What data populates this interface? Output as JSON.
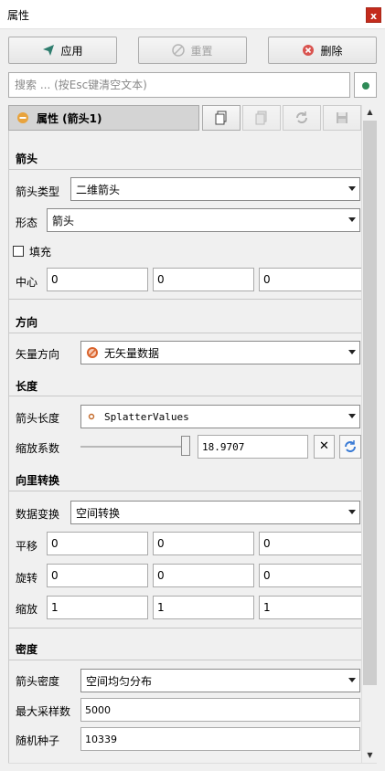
{
  "window": {
    "title": "属性",
    "close_glyph": "x"
  },
  "toolbar": {
    "apply_label": "应用",
    "reset_label": "重置",
    "delete_label": "删除"
  },
  "search": {
    "placeholder": "搜索 ... (按Esc键清空文本)"
  },
  "object_header": {
    "label": "属性 (箭头1)"
  },
  "sections": {
    "arrow": {
      "title": "箭头",
      "type_label": "箭头类型",
      "type_value": "二维箭头",
      "shape_label": "形态",
      "shape_value": "箭头",
      "fill_label": "填充",
      "fill_checked": false,
      "center_label": "中心",
      "center_values": [
        "0",
        "0",
        "0"
      ]
    },
    "direction": {
      "title": "方向",
      "vector_label": "矢量方向",
      "vector_value": "无矢量数据"
    },
    "length": {
      "title": "长度",
      "arrow_length_label": "箭头长度",
      "arrow_length_value": "SplatterValues",
      "scale_label": "缩放系数",
      "scale_value": "18.9707",
      "slider_fraction": 0.9
    },
    "transform": {
      "title": "向里转换",
      "data_transform_label": "数据变换",
      "data_transform_value": "空间转换",
      "translate_label": "平移",
      "translate_values": [
        "0",
        "0",
        "0"
      ],
      "rotate_label": "旋转",
      "rotate_values": [
        "0",
        "0",
        "0"
      ],
      "scale_label": "缩放",
      "scale_values": [
        "1",
        "1",
        "1"
      ]
    },
    "density": {
      "title": "密度",
      "arrow_density_label": "箭头密度",
      "arrow_density_value": "空间均匀分布",
      "max_samples_label": "最大采样数",
      "max_samples_value": "5000",
      "seed_label": "随机种子",
      "seed_value": "10339"
    }
  },
  "icons": {
    "apply": "send-arrow-icon",
    "reset": "reset-icon",
    "delete": "delete-x-icon",
    "header": "minus-circle-icon",
    "copy": "copy-icon",
    "paste": "paste-icon",
    "refresh": "refresh-icon",
    "save": "save-icon",
    "no_vector": "prohibited-icon",
    "point_source": "point-source-icon",
    "status": "status-dot-icon"
  },
  "colors": {
    "apply_icon": "#2f7d6e",
    "delete_icon": "#d9534f",
    "header_icon": "#e8a33d",
    "status_dot": "#2e8b57",
    "no_vector_icon": "#d9622b",
    "refresh_icon": "#3a7bd5"
  }
}
